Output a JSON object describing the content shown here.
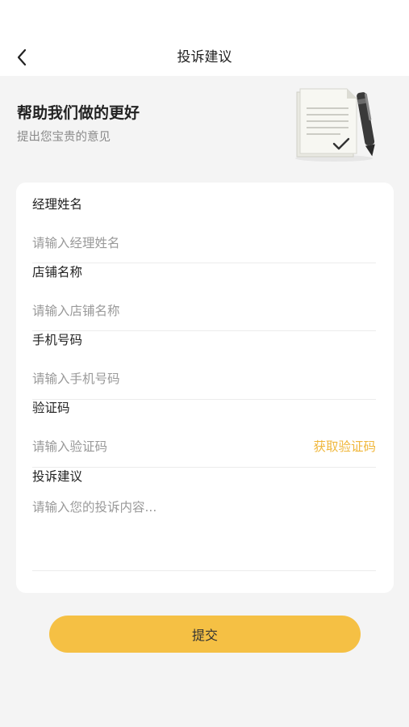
{
  "header": {
    "title": "投诉建议",
    "back_icon": "chevron-left-icon"
  },
  "banner": {
    "title": "帮助我们做的更好",
    "subtitle": "提出您宝贵的意见",
    "illustration": "document-pen-icon"
  },
  "form": {
    "manager_name": {
      "label": "经理姓名",
      "placeholder": "请输入经理姓名",
      "value": ""
    },
    "store_name": {
      "label": "店铺名称",
      "placeholder": "请输入店铺名称",
      "value": ""
    },
    "phone": {
      "label": "手机号码",
      "placeholder": "请输入手机号码",
      "value": ""
    },
    "code": {
      "label": "验证码",
      "placeholder": "请输入验证码",
      "value": "",
      "action_label": "获取验证码"
    },
    "complaint": {
      "label": "投诉建议",
      "placeholder": "请输入您的投诉内容...",
      "value": ""
    }
  },
  "submit_label": "提交",
  "colors": {
    "accent": "#f5c044",
    "link": "#f0b73b",
    "page_bg": "#f4f4f4",
    "card_bg": "#ffffff"
  }
}
